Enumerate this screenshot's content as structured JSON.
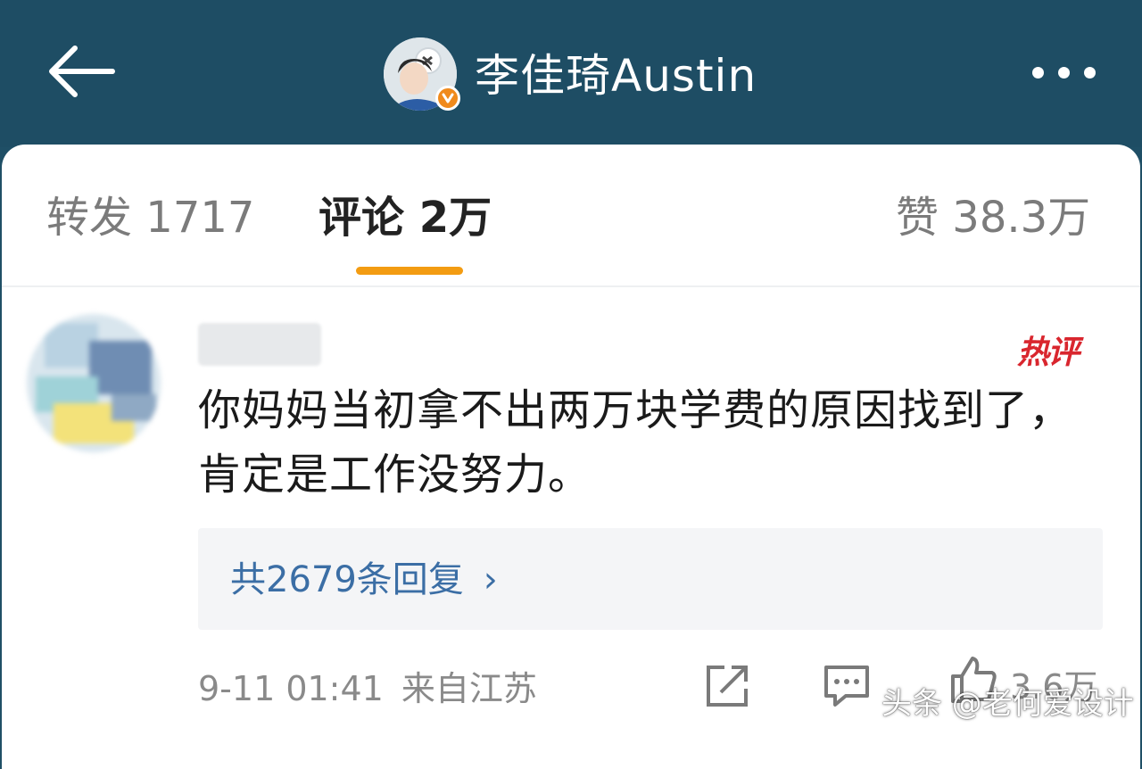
{
  "header": {
    "title": "李佳琦Austin",
    "back_icon": "arrow-left-icon",
    "more_icon": "ellipsis-icon",
    "badge_color": "#f08a1c",
    "bg_color": "#1e4d64"
  },
  "tabs": [
    {
      "label": "转发",
      "count": "1717"
    },
    {
      "label": "评论",
      "count": "2万",
      "active": true
    },
    {
      "label": "赞",
      "count": "38.3万"
    }
  ],
  "accent_color": "#f39c12",
  "comment": {
    "badge": "热评",
    "text": "你妈妈当初拿不出两万块学费的原因找到了，肯定是工作没努力。",
    "replies_label": "共2679条回复",
    "timestamp": "9-11 01:41",
    "location": "来自江苏",
    "like_count": "3.6万"
  },
  "watermark": "头条 @老何爱设计"
}
